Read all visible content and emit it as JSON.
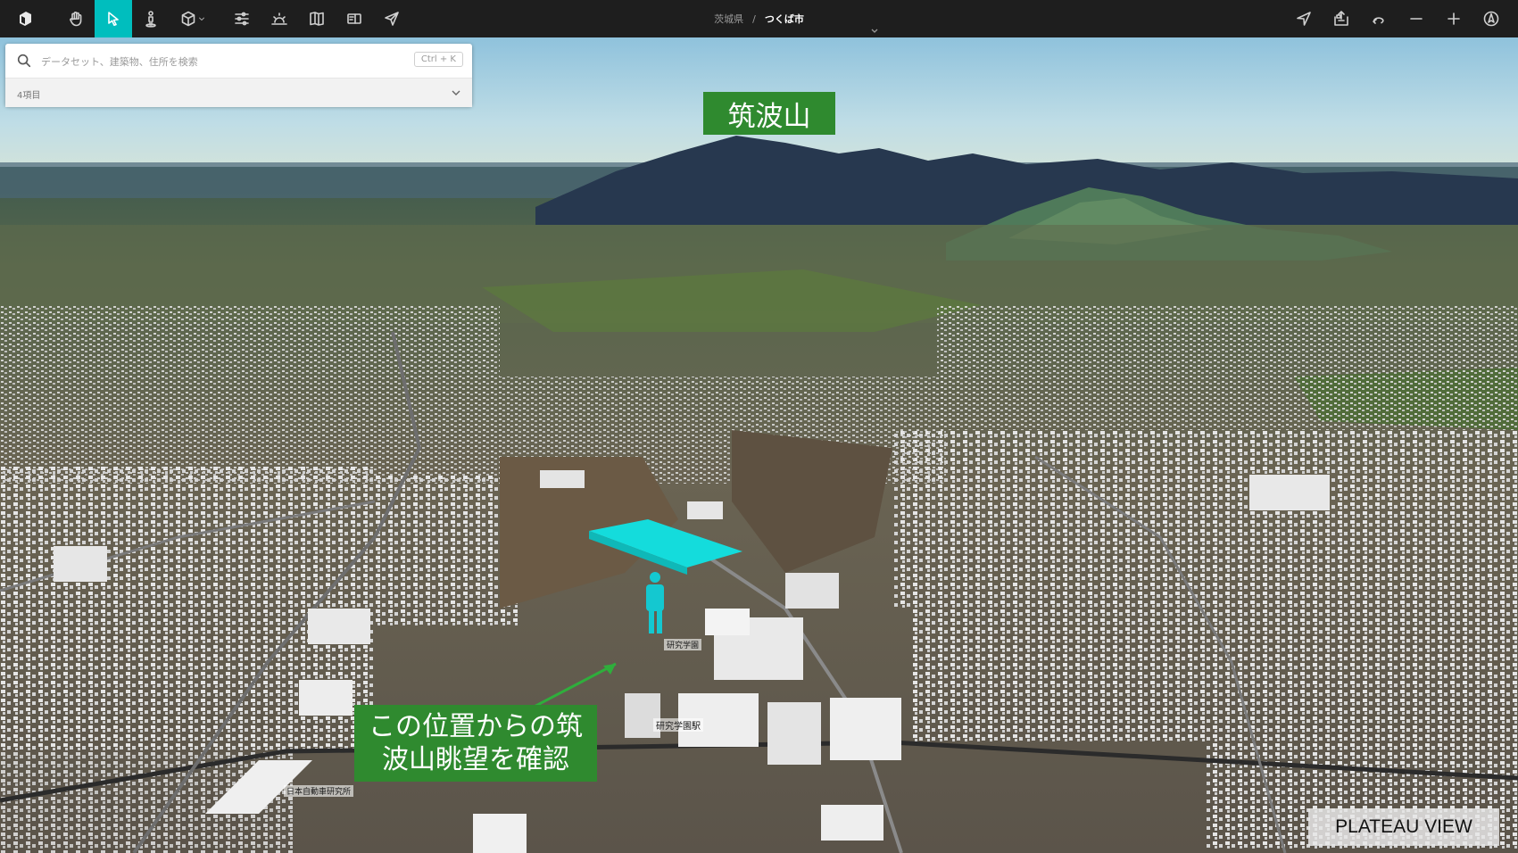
{
  "toolbar": {
    "tools": [
      {
        "name": "hand-tool-button",
        "icon": "hand-icon"
      },
      {
        "name": "select-tool-button",
        "icon": "cursor-icon",
        "active": true
      },
      {
        "name": "pedestrian-tool-button",
        "icon": "person-pin-icon"
      },
      {
        "name": "3d-tool-button",
        "icon": "cube-icon"
      },
      {
        "name": "settings-button",
        "icon": "sliders-icon"
      },
      {
        "name": "sun-button",
        "icon": "sunrise-icon"
      },
      {
        "name": "map-button",
        "icon": "map-icon"
      },
      {
        "name": "story-button",
        "icon": "story-icon"
      },
      {
        "name": "share-button",
        "icon": "send-icon"
      }
    ],
    "right_tools": [
      {
        "name": "location-button",
        "icon": "location-arrow-icon"
      },
      {
        "name": "screenshot-button",
        "icon": "export-icon"
      },
      {
        "name": "rotate-button",
        "icon": "rotate-icon"
      },
      {
        "name": "zoom-out-button",
        "icon": "minus-icon"
      },
      {
        "name": "zoom-in-button",
        "icon": "plus-icon"
      },
      {
        "name": "compass-button",
        "icon": "compass-icon"
      }
    ]
  },
  "breadcrumb": {
    "prefecture": "茨城県",
    "separator": "/",
    "city": "つくば市"
  },
  "search": {
    "placeholder": "データセット、建築物、住所を検索",
    "shortcut": "Ctrl + K",
    "result_count": "4項目"
  },
  "labels": {
    "mountain": "筑波山",
    "callout": "この位置からの筑波山眺望を確認",
    "watermark": "PLATEAU VIEW",
    "station": "研究学園駅",
    "station_small": "研究学園",
    "institute": "日本自動車研究所"
  },
  "colors": {
    "accent": "#00bebe",
    "label_green": "#2f8a2f",
    "highlight_cyan": "#14dcdc"
  }
}
